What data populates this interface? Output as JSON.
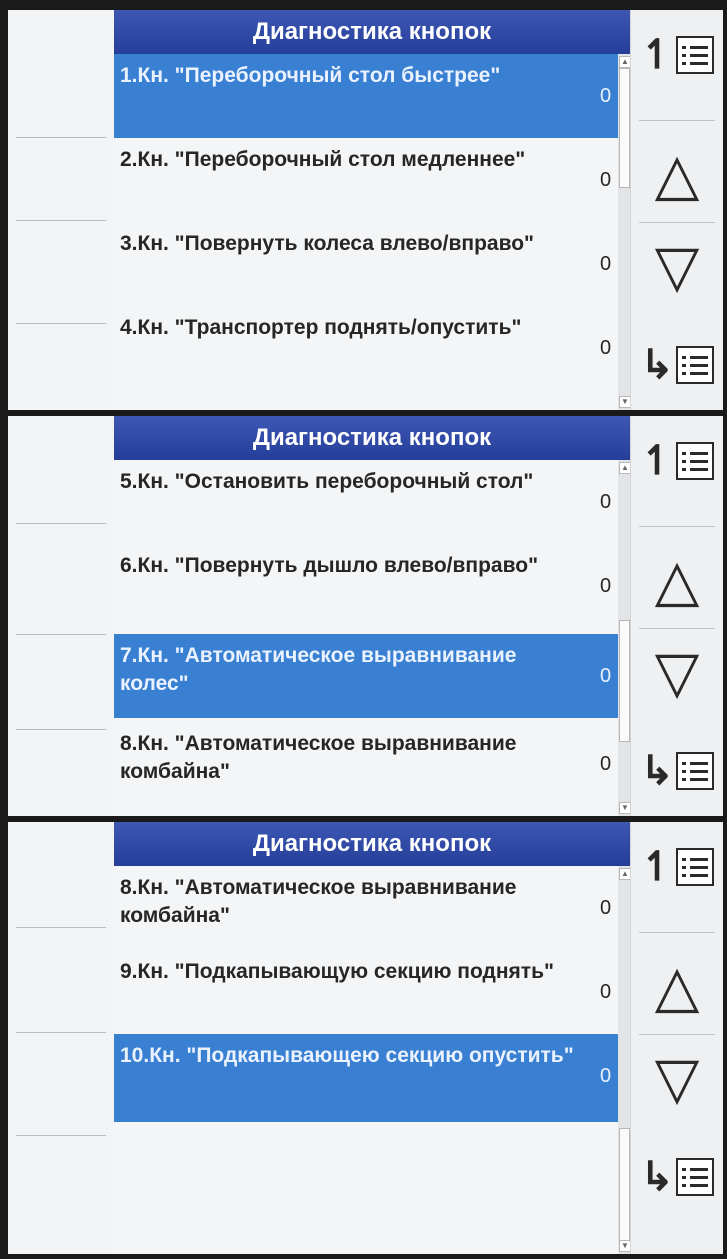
{
  "screens": [
    {
      "title": "Диагностика кнопок",
      "items": [
        {
          "label": "1.Кн. \"Переборочный стол быстрее\"",
          "value": "0",
          "selected": true
        },
        {
          "label": "2.Кн. \"Переборочный стол медленнее\"",
          "value": "0",
          "selected": false
        },
        {
          "label": "3.Кн. \"Повернуть колеса влево/вправо\"",
          "value": "0",
          "selected": false
        },
        {
          "label": "4.Кн. \"Транспортер поднять/опустить\"",
          "value": "0",
          "selected": false
        }
      ]
    },
    {
      "title": "Диагностика кнопок",
      "items": [
        {
          "label": "5.Кн. \"Остановить переборочный стол\"",
          "value": "0",
          "selected": false
        },
        {
          "label": "6.Кн. \"Повернуть дышло влево/вправо\"",
          "value": "0",
          "selected": false
        },
        {
          "label": "7.Кн. \"Автоматическое выравнивание колес\"",
          "value": "0",
          "selected": true
        },
        {
          "label": "8.Кн. \"Автоматическое выравнивание комбайна\"",
          "value": "0",
          "selected": false
        }
      ]
    },
    {
      "title": "Диагностика кнопок",
      "items": [
        {
          "label": "8.Кн. \"Автоматическое выравнивание комбайна\"",
          "value": "0",
          "selected": false
        },
        {
          "label": "9.Кн. \"Подкапывающую секцию поднять\"",
          "value": "0",
          "selected": false
        },
        {
          "label": "10.Кн. \"Подкапывающею секцию опустить\"",
          "value": "0",
          "selected": true
        }
      ]
    }
  ],
  "side_buttons": [
    {
      "icon": "list-top-icon"
    },
    {
      "icon": "arrow-up-icon"
    },
    {
      "icon": "arrow-down-icon"
    },
    {
      "icon": "list-bottom-icon"
    }
  ],
  "colors": {
    "header": "#2e47a6",
    "selected_row": "#3a80d2",
    "background": "#f4f5f7"
  }
}
